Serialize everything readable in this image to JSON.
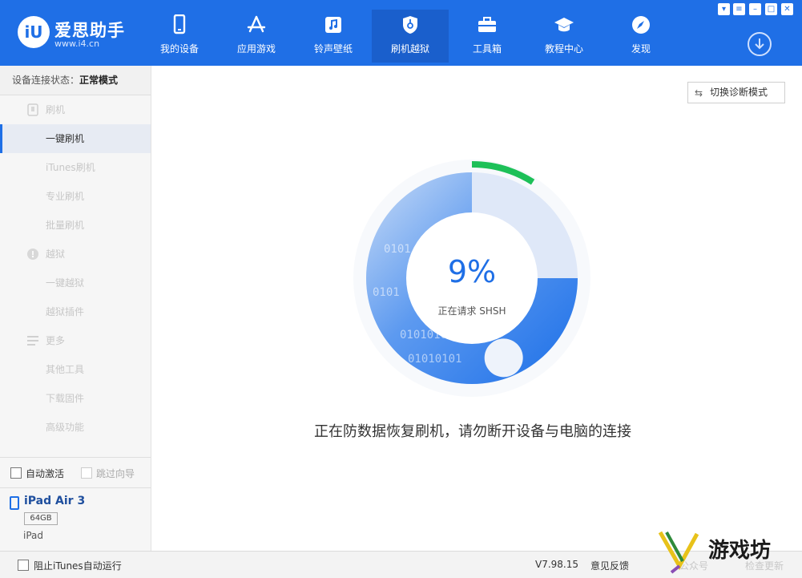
{
  "brand": {
    "name": "爱思助手",
    "url": "www.i4.cn",
    "logo_mark": "iU"
  },
  "nav": [
    {
      "label": "我的设备",
      "icon": "phone-icon"
    },
    {
      "label": "应用游戏",
      "icon": "app-store-icon"
    },
    {
      "label": "铃声壁纸",
      "icon": "music-icon"
    },
    {
      "label": "刷机越狱",
      "icon": "shield-icon",
      "active": true
    },
    {
      "label": "工具箱",
      "icon": "toolbox-icon"
    },
    {
      "label": "教程中心",
      "icon": "graduation-cap-icon"
    },
    {
      "label": "发现",
      "icon": "compass-icon"
    }
  ],
  "window_controls": [
    "shirt-icon",
    "menu-icon",
    "minimize-icon",
    "maximize-icon",
    "close-icon"
  ],
  "sidebar": {
    "status_key": "设备连接状态：",
    "status_value": "正常模式",
    "groups": [
      {
        "label": "刷机",
        "icon": "phone-icon",
        "items": [
          {
            "label": "一键刷机",
            "active": true
          },
          {
            "label": "iTunes刷机"
          },
          {
            "label": "专业刷机"
          },
          {
            "label": "批量刷机"
          }
        ]
      },
      {
        "label": "越狱",
        "icon": "jailbreak-icon",
        "items": [
          {
            "label": "一键越狱"
          },
          {
            "label": "越狱插件"
          }
        ]
      },
      {
        "label": "更多",
        "icon": "list-icon",
        "items": [
          {
            "label": "其他工具"
          },
          {
            "label": "下载固件"
          },
          {
            "label": "高级功能"
          }
        ]
      }
    ],
    "options": {
      "auto_activate": "自动激活",
      "skip_guide": "跳过向导"
    },
    "device": {
      "name": "iPad Air 3",
      "capacity": "64GB",
      "type": "iPad"
    }
  },
  "main": {
    "diag_button": "切换诊断模式",
    "progress": {
      "percent_label": "9%",
      "value": 0.09,
      "status": "正在请求 SHSH"
    },
    "warning": "正在防数据恢复刷机，请勿断开设备与电脑的连接",
    "binary_texts": [
      "0101",
      "0101",
      "01010101",
      "01010101"
    ]
  },
  "statusbar": {
    "block_itunes": "阻止iTunes自动运行",
    "version": "V7.98.15",
    "feedback": "意见反馈",
    "faint_1": "公众号",
    "faint_2": "检查更新"
  },
  "watermark": {
    "text": "游戏坊"
  },
  "colors": {
    "primary": "#1f6fe6",
    "progress": "#1dc058",
    "ring_light": "#dfe8f8"
  }
}
